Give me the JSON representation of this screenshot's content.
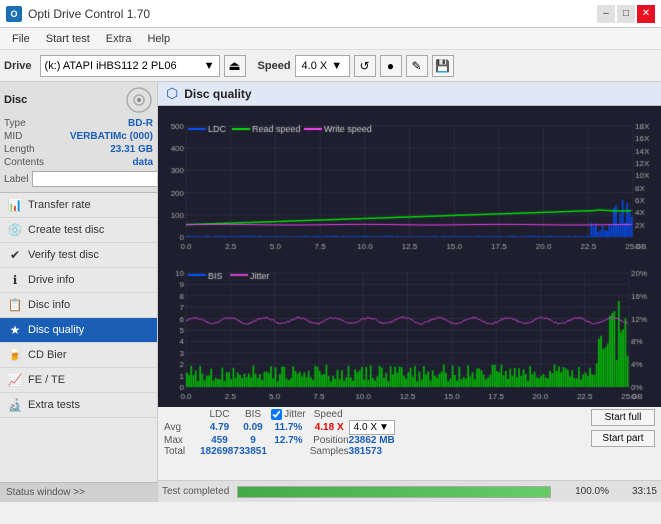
{
  "app": {
    "title": "Opti Drive Control 1.70",
    "icon": "O"
  },
  "titlebar": {
    "minimize_label": "–",
    "maximize_label": "□",
    "close_label": "✕"
  },
  "menubar": {
    "items": [
      "File",
      "Start test",
      "Extra",
      "Help"
    ]
  },
  "toolbar": {
    "drive_label": "Drive",
    "drive_value": "(k:) ATAPI iHBS112  2 PL06",
    "eject_icon": "⏏",
    "speed_label": "Speed",
    "speed_value": "4.0 X",
    "icon1": "↺",
    "icon2": "●",
    "icon3": "🖊",
    "icon4": "💾"
  },
  "sidebar": {
    "disc_section": {
      "title": "Disc",
      "type_label": "Type",
      "type_value": "BD-R",
      "mid_label": "MID",
      "mid_value": "VERBATIMc (000)",
      "length_label": "Length",
      "length_value": "23.31 GB",
      "contents_label": "Contents",
      "contents_value": "data",
      "label_label": "Label",
      "label_placeholder": ""
    },
    "items": [
      {
        "id": "transfer-rate",
        "label": "Transfer rate",
        "icon": "📊"
      },
      {
        "id": "create-test-disc",
        "label": "Create test disc",
        "icon": "💿"
      },
      {
        "id": "verify-test-disc",
        "label": "Verify test disc",
        "icon": "✔"
      },
      {
        "id": "drive-info",
        "label": "Drive info",
        "icon": "ℹ"
      },
      {
        "id": "disc-info",
        "label": "Disc info",
        "icon": "📋"
      },
      {
        "id": "disc-quality",
        "label": "Disc quality",
        "icon": "★",
        "active": true
      },
      {
        "id": "cd-bier",
        "label": "CD Bier",
        "icon": "🍺"
      },
      {
        "id": "fe-te",
        "label": "FE / TE",
        "icon": "📈"
      },
      {
        "id": "extra-tests",
        "label": "Extra tests",
        "icon": "🔬"
      }
    ],
    "status_label": "Status window >>"
  },
  "content": {
    "header_icon": "⬡",
    "header_title": "Disc quality",
    "chart_upper": {
      "legend": [
        {
          "label": "LDC",
          "color": "#0000ff"
        },
        {
          "label": "Read speed",
          "color": "#00ff00"
        },
        {
          "label": "Write speed",
          "color": "#ff00ff"
        }
      ],
      "y_max": 500,
      "y_right_max": 18,
      "x_max": 25,
      "grid_color": "#3a3a5a"
    },
    "chart_lower": {
      "legend": [
        {
          "label": "BIS",
          "color": "#0000ff"
        },
        {
          "label": "Jitter",
          "color": "#ff00ff"
        }
      ],
      "y_max": 10,
      "y_right_max": 20,
      "x_max": 25
    }
  },
  "stats": {
    "columns": [
      "LDC",
      "BIS",
      "",
      "Jitter",
      "Speed",
      ""
    ],
    "avg_label": "Avg",
    "avg_ldc": "4.79",
    "avg_bis": "0.09",
    "avg_jitter": "11.7%",
    "avg_speed": "4.18 X",
    "avg_speed_setting": "4.0 X",
    "max_label": "Max",
    "max_ldc": "459",
    "max_bis": "9",
    "max_jitter": "12.7%",
    "max_position": "23862 MB",
    "total_label": "Total",
    "total_ldc": "1826987",
    "total_bis": "33851",
    "total_samples": "381573",
    "position_label": "Position",
    "samples_label": "Samples",
    "start_full_label": "Start full",
    "start_part_label": "Start part",
    "jitter_checked": true,
    "jitter_label": "Jitter"
  },
  "progress": {
    "status_text": "Test completed",
    "percent": 100,
    "percent_text": "100.0%",
    "time_text": "33:15"
  },
  "colors": {
    "bg_chart": "#1e1e2e",
    "grid": "#3a3a5a",
    "ldc_upper": "#0044ff",
    "read_speed": "#00dd00",
    "write_speed": "#ff00ff",
    "bis": "#0044ff",
    "jitter": "#cc00cc",
    "accent": "#1a5fb5"
  }
}
